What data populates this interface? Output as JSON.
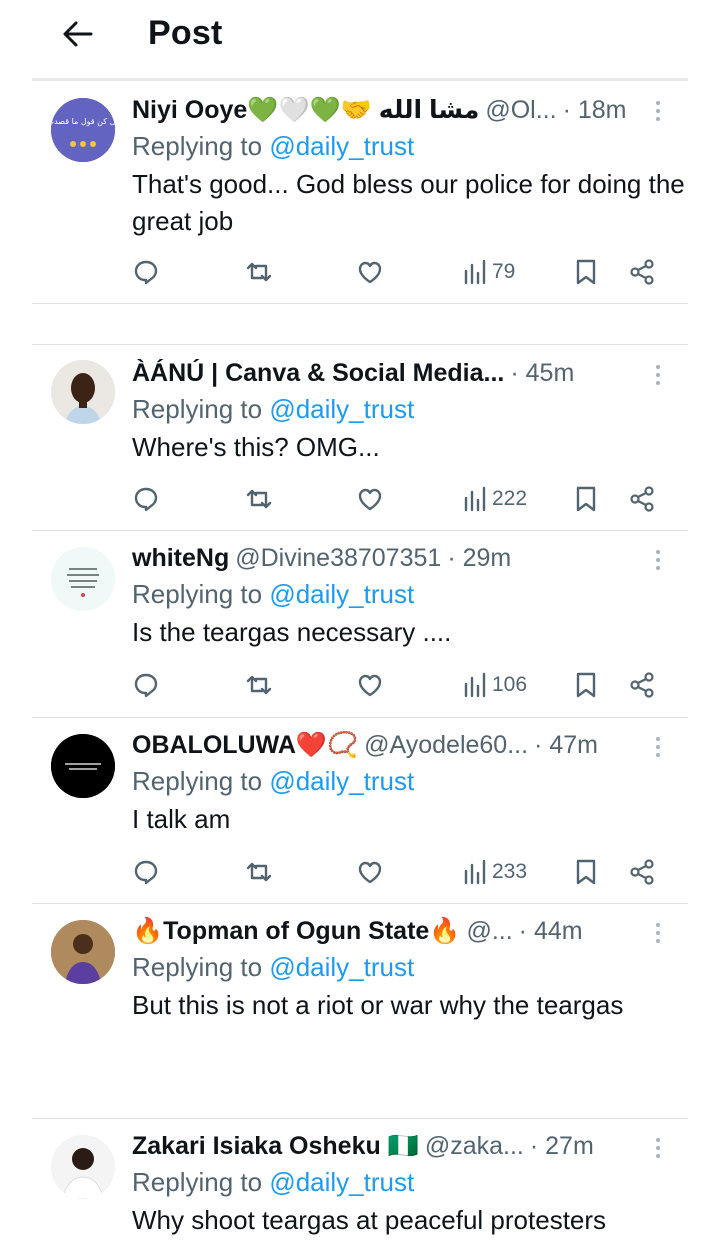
{
  "header": {
    "title": "Post",
    "back_icon": "arrow-left-icon"
  },
  "colors": {
    "accent": "#1d9bf0",
    "secondary_text": "#536471",
    "primary_text": "#0f1419"
  },
  "replies": [
    {
      "name": "Niyi Ooye💚🤍💚🤝 مشا الله",
      "handle": "@Ol...",
      "time": "· 18m",
      "replying_prefix": "Replying to ",
      "replying_to": "@daily_trust",
      "text": "That's good... God bless our police for doing the great job",
      "views": "79",
      "avatar_text": "كل كن قول ما قصدت"
    },
    {
      "name": "ÀÁNÚ | Canva & Social Media...",
      "handle": "",
      "time": "· 45m",
      "replying_prefix": "Replying to ",
      "replying_to": "@daily_trust",
      "text": "Where's this? OMG...",
      "views": "222"
    },
    {
      "name": "whiteNg",
      "handle": "@Divine38707351",
      "time": "· 29m",
      "replying_prefix": "Replying to ",
      "replying_to": "@daily_trust",
      "text": "Is the teargas necessary ....",
      "views": "106"
    },
    {
      "name": "OBALOLUWA❤️📿",
      "handle": "@Ayodele60...",
      "time": "· 47m",
      "replying_prefix": "Replying to ",
      "replying_to": "@daily_trust",
      "text": "I talk am",
      "views": "233"
    },
    {
      "name": "🔥Topman of Ogun State🔥",
      "handle": "@...",
      "time": "· 44m",
      "replying_prefix": "Replying to ",
      "replying_to": "@daily_trust",
      "text": "But this is not a riot or war why the teargas",
      "views": ""
    },
    {
      "name": "Zakari Isiaka Osheku 🇳🇬",
      "handle": "@zaka...",
      "time": "· 27m",
      "replying_prefix": "Replying to ",
      "replying_to": "@daily_trust",
      "text": "Why shoot teargas at peaceful protesters",
      "views": ""
    }
  ]
}
